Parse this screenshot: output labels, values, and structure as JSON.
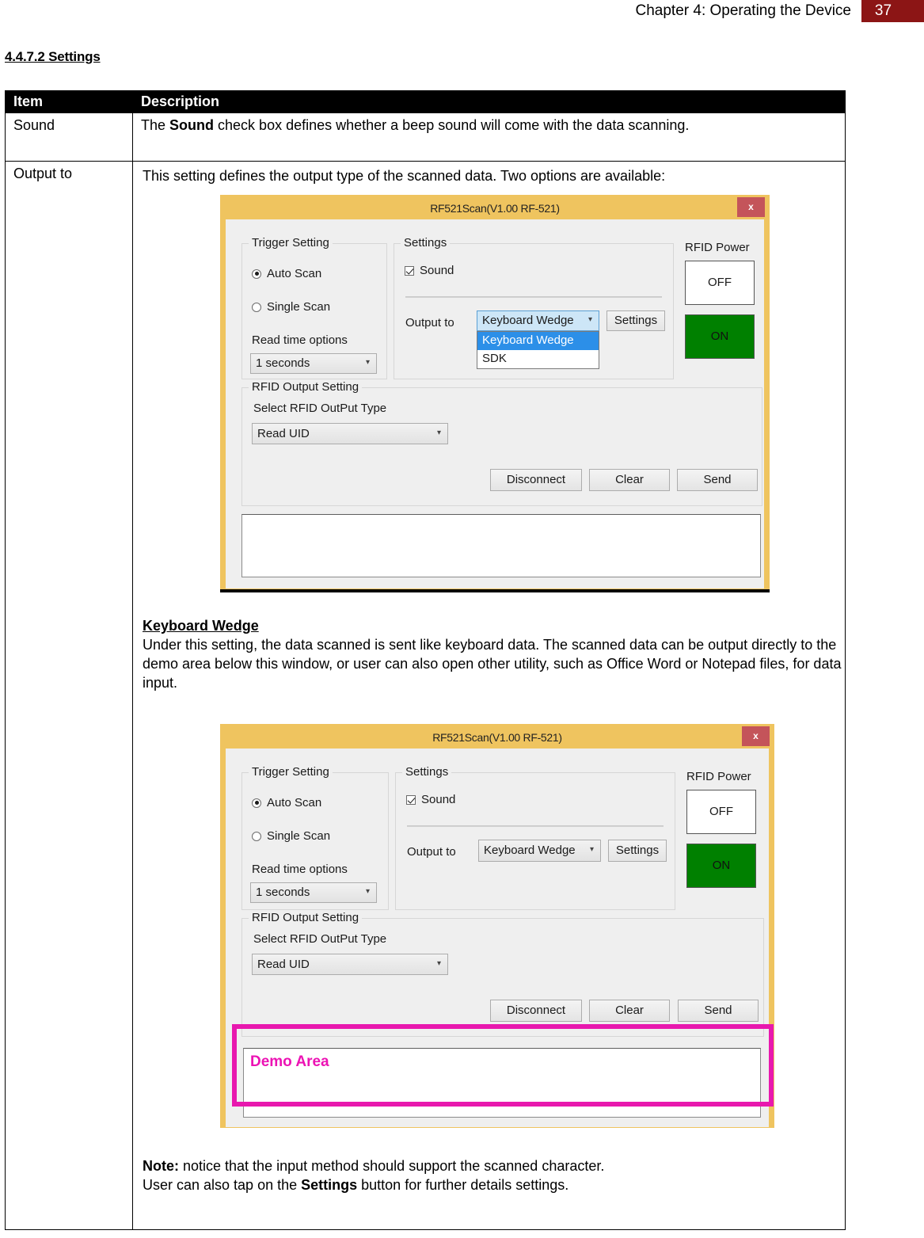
{
  "header": {
    "chapter_title": "Chapter 4: Operating the Device",
    "page_number": "37",
    "accent_color": "#8C1515"
  },
  "section": {
    "heading": "4.4.7.2 Settings"
  },
  "table": {
    "columns": [
      "Item",
      "Description"
    ],
    "rows": [
      {
        "item": "Sound",
        "desc_prefix": "The ",
        "desc_bold": "Sound",
        "desc_suffix": " check box defines whether a beep sound will come with the data scanning."
      },
      {
        "item": "Output to",
        "intro": "This setting defines the output type of the scanned data. Two options are available:"
      }
    ]
  },
  "keyboard_wedge": {
    "title": "Keyboard Wedge",
    "paragraph": "Under this setting, the data scanned is sent like keyboard data. The scanned data can be output directly to the demo area below this window, or user can also open other utility, such as Office Word or Notepad files, for data input."
  },
  "note": {
    "label": "Note:",
    "line1": " notice that the input method should support the scanned character.",
    "line2_prefix": "User can also tap on the ",
    "line2_bold": "Settings",
    "line2_suffix": " button for further details settings."
  },
  "dialog1": {
    "title": "RF521Scan(V1.00 RF-521)",
    "close_label": "x",
    "trigger_group": {
      "legend": "Trigger Setting",
      "auto_scan": "Auto Scan",
      "auto_scan_selected": true,
      "single_scan": "Single Scan",
      "single_scan_selected": false,
      "read_time_label": "Read time options",
      "read_time_value": "1 seconds"
    },
    "settings_group": {
      "legend": "Settings",
      "sound_label": "Sound",
      "sound_checked": true,
      "output_to_label": "Output to",
      "output_to_value": "Keyboard Wedge",
      "output_options": [
        "Keyboard Wedge",
        "SDK"
      ],
      "output_selected_index": 0,
      "dropdown_open": true,
      "settings_button": "Settings"
    },
    "rfid_power": {
      "legend": "RFID Power",
      "off_label": "OFF",
      "on_label": "ON",
      "on_color": "#008000"
    },
    "rfid_output_group": {
      "legend": "RFID Output Setting",
      "select_label": "Select RFID OutPut Type",
      "select_value": "Read UID",
      "buttons": [
        "Disconnect",
        "Clear",
        "Send"
      ]
    },
    "output_textarea_value": ""
  },
  "dialog2": {
    "title": "RF521Scan(V1.00 RF-521)",
    "close_label": "x",
    "trigger_group": {
      "legend": "Trigger Setting",
      "auto_scan": "Auto Scan",
      "auto_scan_selected": true,
      "single_scan": "Single Scan",
      "single_scan_selected": false,
      "read_time_label": "Read time options",
      "read_time_value": "1 seconds"
    },
    "settings_group": {
      "legend": "Settings",
      "sound_label": "Sound",
      "sound_checked": true,
      "output_to_label": "Output to",
      "output_to_value": "Keyboard Wedge",
      "settings_button": "Settings"
    },
    "rfid_power": {
      "legend": "RFID Power",
      "off_label": "OFF",
      "on_label": "ON",
      "on_color": "#008000"
    },
    "rfid_output_group": {
      "legend": "RFID Output Setting",
      "select_label": "Select RFID OutPut Type",
      "select_value": "Read UID",
      "buttons": [
        "Disconnect",
        "Clear",
        "Send"
      ]
    },
    "demo_area": {
      "label": "Demo Area",
      "highlight_color": "#E818AE"
    }
  }
}
